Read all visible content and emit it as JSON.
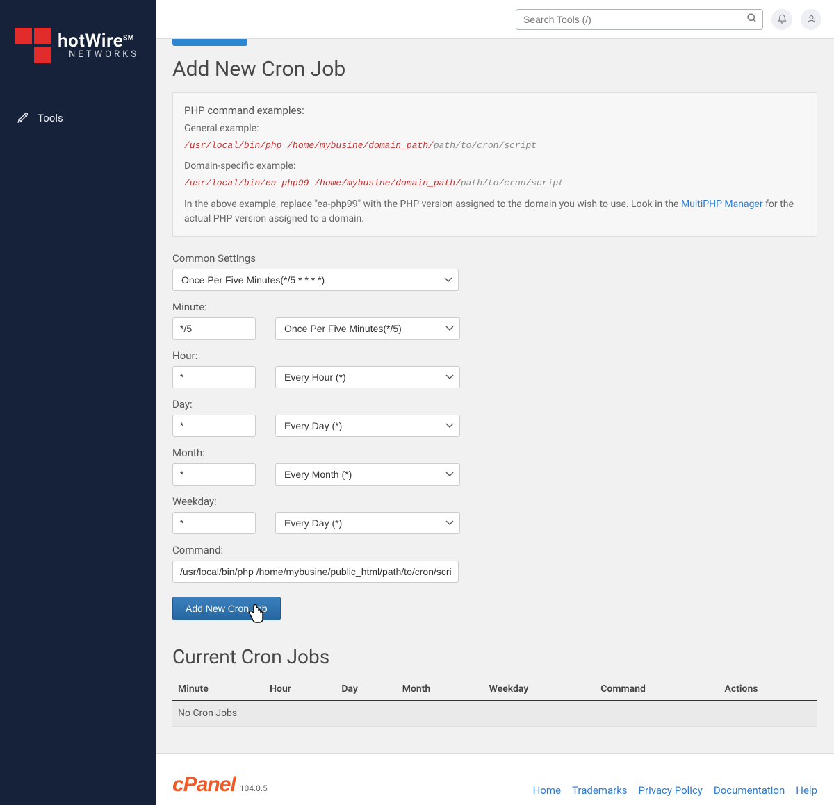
{
  "brand": {
    "line1": "hotWire",
    "sm": "SM",
    "line2": "NETWORKS"
  },
  "sidebar": {
    "tools_label": "Tools"
  },
  "topbar": {
    "search_placeholder": "Search Tools (/)"
  },
  "page": {
    "title": "Add New Cron Job",
    "info": {
      "heading": "PHP command examples:",
      "general_label": "General example:",
      "general_cmd_part1": "/usr/local/bin/php /home/mybusine/domain_path/",
      "general_cmd_part2": "path/to/cron/script",
      "domain_label": "Domain-specific example:",
      "domain_cmd_part1": "/usr/local/bin/ea-php99 /home/mybusine/domain_path/",
      "domain_cmd_part2": "path/to/cron/script",
      "note_prefix": "In the above example, replace \"ea-php99\" with the PHP version assigned to the domain you wish to use. Look in the ",
      "note_link": "MultiPHP Manager",
      "note_suffix": " for the actual PHP version assigned to a domain."
    },
    "common_settings_label": "Common Settings",
    "common_settings_value": "Once Per Five Minutes(*/5 * * * *)",
    "fields": {
      "minute": {
        "label": "Minute:",
        "value": "*/5",
        "preset": "Once Per Five Minutes(*/5)"
      },
      "hour": {
        "label": "Hour:",
        "value": "*",
        "preset": "Every Hour (*)"
      },
      "day": {
        "label": "Day:",
        "value": "*",
        "preset": "Every Day (*)"
      },
      "month": {
        "label": "Month:",
        "value": "*",
        "preset": "Every Month (*)"
      },
      "weekday": {
        "label": "Weekday:",
        "value": "*",
        "preset": "Every Day (*)"
      }
    },
    "command_label": "Command:",
    "command_value": "/usr/local/bin/php /home/mybusine/public_html/path/to/cron/script",
    "submit_label": "Add New Cron Job"
  },
  "current": {
    "title": "Current Cron Jobs",
    "columns": [
      "Minute",
      "Hour",
      "Day",
      "Month",
      "Weekday",
      "Command",
      "Actions"
    ],
    "empty": "No Cron Jobs"
  },
  "footer": {
    "product": "cPanel",
    "version": "104.0.5",
    "links": [
      "Home",
      "Trademarks",
      "Privacy Policy",
      "Documentation",
      "Help"
    ]
  }
}
